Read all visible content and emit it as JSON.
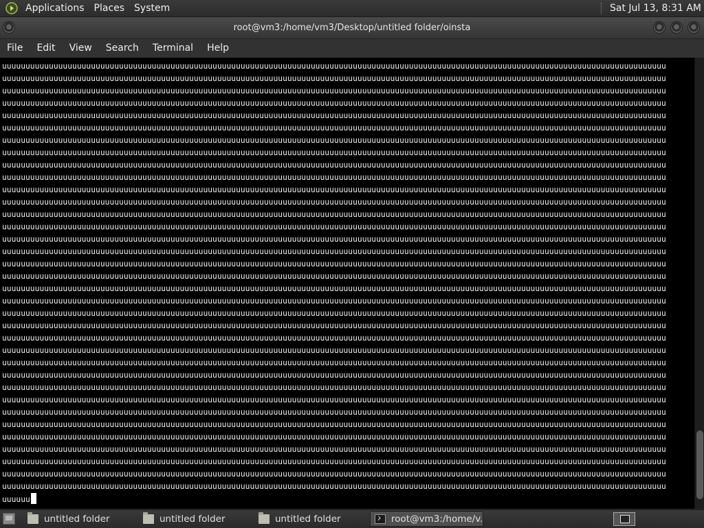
{
  "top_panel": {
    "menus": [
      "Applications",
      "Places",
      "System"
    ],
    "clock": "Sat Jul 13,  8:31 AM"
  },
  "window": {
    "title": "root@vm3:/home/vm3/Desktop/untitled folder/oinsta"
  },
  "menubar": {
    "items": [
      "File",
      "Edit",
      "View",
      "Search",
      "Terminal",
      "Help"
    ]
  },
  "terminal": {
    "output_char": "u",
    "chars_per_row": 142,
    "full_rows": 35,
    "last_row": "uuuuuu"
  },
  "taskbar": {
    "tasks": [
      {
        "label": "untitled folder",
        "icon": "folder-icon"
      },
      {
        "label": "untitled folder",
        "icon": "folder-icon"
      },
      {
        "label": "untitled folder",
        "icon": "folder-icon"
      },
      {
        "label": "root@vm3:/home/v...",
        "icon": "terminal-icon"
      }
    ]
  },
  "colors": {
    "panel": "#2c2c2c",
    "terminal_bg": "#000000",
    "terminal_fg": "#f0f0f0"
  }
}
